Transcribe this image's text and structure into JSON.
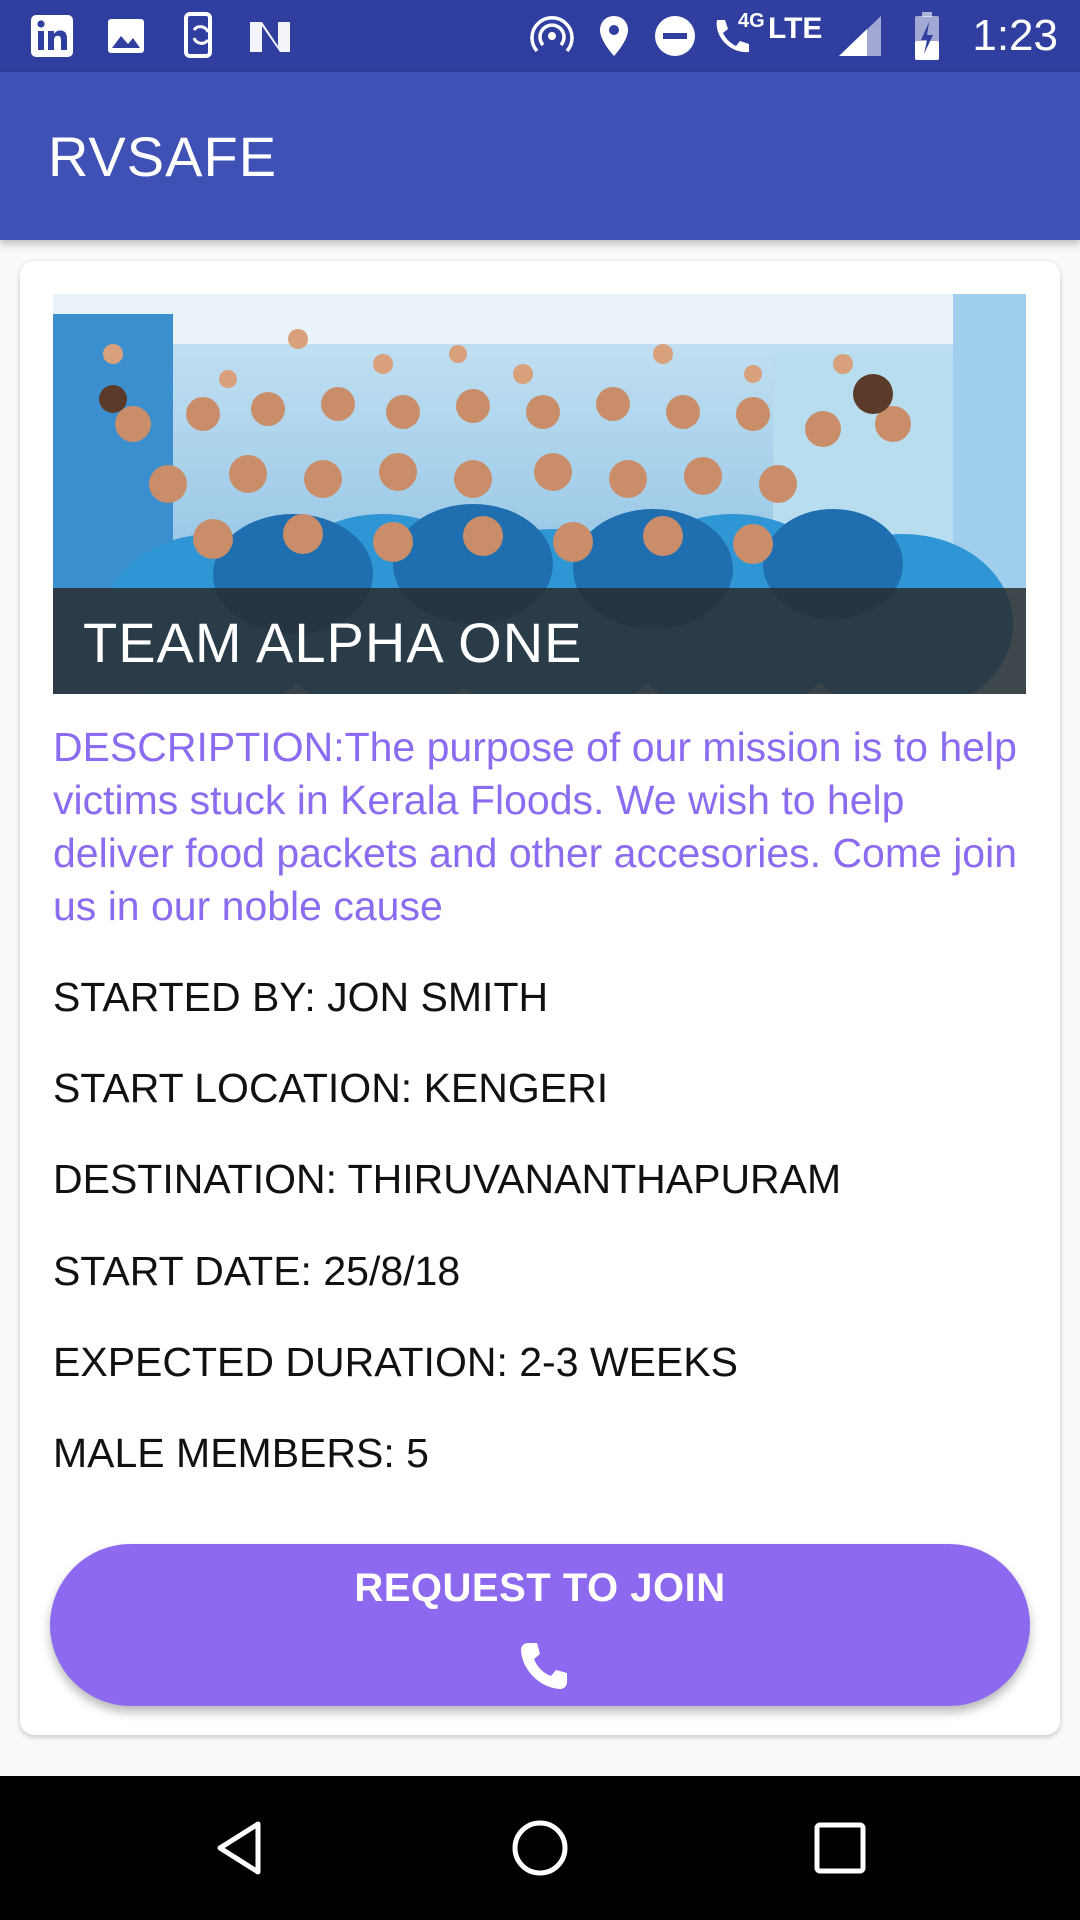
{
  "status_bar": {
    "time": "1:23",
    "network_label": "4G",
    "lte_label": "LTE",
    "icons": [
      "linkedin-icon",
      "image-icon",
      "phone-sync-icon",
      "n-app-icon",
      "hotspot-icon",
      "location-icon",
      "dnd-icon",
      "wifi-call-icon",
      "signal-icon",
      "battery-charging-icon"
    ]
  },
  "app_bar": {
    "title": "RVSAFE"
  },
  "card": {
    "image_caption": "TEAM ALPHA ONE",
    "description": "DESCRIPTION:The purpose of our mission is to help victims stuck in Kerala Floods. We wish to help deliver food packets and other accesories. Come join us in our noble cause",
    "started_by": "STARTED BY: JON SMITH",
    "start_location": "START LOCATION: KENGERI",
    "destination": "DESTINATION: THIRUVANANTHAPURAM",
    "start_date": "START DATE: 25/8/18",
    "expected_duration": "EXPECTED DURATION: 2-3 WEEKS",
    "male_members": "MALE MEMBERS: 5",
    "join_button_label": "REQUEST TO JOIN"
  },
  "nav_bar": {
    "buttons": [
      "back-icon",
      "home-icon",
      "recents-icon"
    ]
  },
  "colors": {
    "status_bar": "#303f9f",
    "app_bar": "#3f51b5",
    "accent": "#8c69ef",
    "description_text": "#8b6cf0"
  }
}
